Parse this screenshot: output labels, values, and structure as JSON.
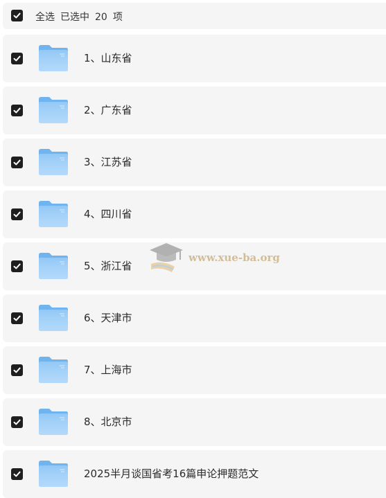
{
  "header": {
    "select_all": "全选",
    "selected_prefix": "已选中",
    "selected_count": "20",
    "selected_suffix": "项"
  },
  "items": [
    {
      "label": "1、山东省",
      "checked": true
    },
    {
      "label": "2、广东省",
      "checked": true
    },
    {
      "label": "3、江苏省",
      "checked": true
    },
    {
      "label": "4、四川省",
      "checked": true
    },
    {
      "label": "5、浙江省",
      "checked": true
    },
    {
      "label": "6、天津市",
      "checked": true
    },
    {
      "label": "7、上海市",
      "checked": true
    },
    {
      "label": "8、北京市",
      "checked": true
    },
    {
      "label": "2025半月谈国省考16篇申论押题范文",
      "checked": true
    }
  ],
  "watermark": {
    "text": "www.xue-ba.org"
  },
  "colors": {
    "row_bg": "#f5f5f6",
    "checkbox": "#1f1f1f",
    "folder": "#6fb4ee",
    "folder_light": "#a9d4fa"
  }
}
